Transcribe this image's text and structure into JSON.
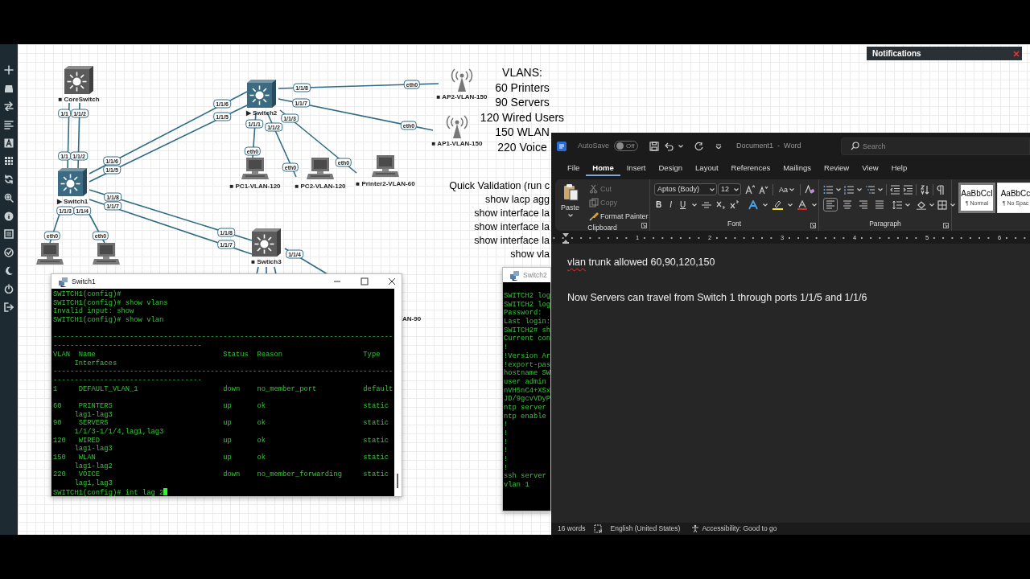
{
  "diagram": {
    "nodes": [
      {
        "kind": "switch",
        "label": "■ CoreSwitch",
        "color": "#5b5b5b"
      },
      {
        "kind": "switch",
        "label": "▶ Switch2",
        "color": "#3a6b82"
      },
      {
        "kind": "ap",
        "label": "■ AP2-VLAN-150"
      },
      {
        "kind": "ap",
        "label": "■ AP1-VLAN-150"
      },
      {
        "kind": "pc",
        "label": "■ PC1-VLAN-120"
      },
      {
        "kind": "pc",
        "label": "■ PC2-VLAN-120"
      },
      {
        "kind": "pc",
        "label": "■ Printer2-VLAN-60"
      },
      {
        "kind": "switch",
        "label": "▶ Switch1",
        "color": "#3a6b82"
      },
      {
        "kind": "switch",
        "label": "■ Swtich3",
        "color": "#5b5b5b"
      },
      {
        "kind": "pc"
      },
      {
        "kind": "pc"
      },
      {
        "kind": "label",
        "label": "AN-90"
      }
    ],
    "ports": [
      "1/1",
      "1/1/2",
      "1/1",
      "1/1/2",
      "1/1/6",
      "1/1/5",
      "1/1/8",
      "1/1/7",
      "1/1/3",
      "1/1/4",
      "1/1/6",
      "1/1/5",
      "1/1/8",
      "1/1/7",
      "1/1/3",
      "1/1/1",
      "1/1/2",
      "eth0",
      "eth0",
      "eth0",
      "eth0",
      "eth0",
      "eth0",
      "eth0",
      "1/1/8",
      "1/1/7",
      "1/1/4"
    ],
    "vlan_note": [
      "VLANS:",
      "60 Printers",
      "90 Servers",
      "120 Wired Users",
      "150 WLAN",
      "220 Voice"
    ],
    "validation_note": [
      "Quick Validation (run c",
      "show lacp agg",
      "show interface la",
      "show interface la",
      "show interface la",
      "show vla"
    ]
  },
  "notifications": {
    "title": "Notifications"
  },
  "switch1": {
    "title": "Switch1",
    "lines": [
      "SWITCH1(config)#",
      "SWITCH1(config)# show vlans",
      "Invalid input: show",
      "SWITCH1(config)# show vlan"
    ],
    "rules_top": [
      "--------------------------------------------------------------------------------",
      "-----------------------------------"
    ],
    "header": {
      "vlan": "VLAN",
      "name": "Name",
      "status": "Status",
      "reason": "Reason",
      "type": "Type",
      "interfaces": "Interfaces"
    },
    "rules_bottom": [
      "--------------------------------------------------------------------------------",
      "-----------------------------------"
    ],
    "rows": [
      {
        "vlan": "1",
        "name": "DEFAULT_VLAN_1",
        "status": "down",
        "reason": "no_member_port",
        "type": "default"
      },
      {
        "vlan": "60",
        "name": "PRINTERS",
        "status": "up",
        "reason": "ok",
        "type": "static",
        "interfaces": "lag1-lag3"
      },
      {
        "vlan": "90",
        "name": "SERVERS",
        "status": "up",
        "reason": "ok",
        "type": "static",
        "interfaces": "1/1/3-1/1/4,lag1,lag3"
      },
      {
        "vlan": "120",
        "name": "WIRED",
        "status": "up",
        "reason": "ok",
        "type": "static",
        "interfaces": "lag1-lag3"
      },
      {
        "vlan": "150",
        "name": "WLAN",
        "status": "up",
        "reason": "ok",
        "type": "static",
        "interfaces": "lag1-lag2"
      },
      {
        "vlan": "220",
        "name": "VOICE",
        "status": "down",
        "reason": "no_member_forwarding",
        "type": "static",
        "interfaces": "lag1,lag3"
      }
    ],
    "prompt": "SWITCH1(config)# int lag 2"
  },
  "switch2": {
    "title": "Switch2",
    "lines": [
      "SWITCH2 log",
      "SWITCH2 log",
      "Password:",
      "Last login:",
      "SWITCH2# sh",
      "Current con",
      "!",
      "!Version Ar",
      "!export-pas",
      "hostname SW",
      "user admin",
      "nVH5nC4+XSx",
      "JD/9gcvVDyP",
      "ntp server",
      "ntp enable",
      "!",
      "!",
      "!",
      "!",
      "!",
      "!",
      "ssh server",
      "vlan 1"
    ]
  },
  "word": {
    "autosave_label": "AutoSave",
    "autosave": {
      "on": false,
      "label": "Off"
    },
    "title": "Document1  -  Word",
    "search_placeholder": "Search",
    "tabs": [
      {
        "label": "File",
        "selected": false
      },
      {
        "label": "Home",
        "selected": true
      },
      {
        "label": "Insert",
        "selected": false
      },
      {
        "label": "Design",
        "selected": false
      },
      {
        "label": "Layout",
        "selected": false
      },
      {
        "label": "References",
        "selected": false
      },
      {
        "label": "Mailings",
        "selected": false
      },
      {
        "label": "Review",
        "selected": false
      },
      {
        "label": "View",
        "selected": false
      },
      {
        "label": "Help",
        "selected": false
      }
    ],
    "paste": "Paste",
    "clipboard_items": [
      {
        "label": "Cut",
        "disabled": true
      },
      {
        "label": "Copy",
        "disabled": true
      },
      {
        "label": "Format Painter",
        "disabled": false
      }
    ],
    "clipboard_group": "Clipboard",
    "font_name": "Aptos (Body)",
    "font_size": "12",
    "change_case": "Aa",
    "style_buttons": [
      "B",
      "I",
      "U"
    ],
    "font_group": "Font",
    "alignments": [
      {
        "selected": true
      },
      {
        "selected": false
      },
      {
        "selected": false
      },
      {
        "selected": false
      }
    ],
    "paragraph_group": "Paragraph",
    "styles": [
      {
        "sample": "AaBbCcI",
        "name": "¶ Normal",
        "selected": true
      },
      {
        "sample": "AaBbCc",
        "name": "¶ No Spac",
        "selected": false
      }
    ],
    "ruler": [
      "1",
      "2",
      "3",
      "4",
      "5",
      "6"
    ],
    "paragraphs": [
      [
        {
          "text": "vlan",
          "misspelled": true
        },
        {
          "text": " trunk allowed 60,90,120,150",
          "misspelled": false
        }
      ],
      [
        {
          "text": "Now Servers can travel from Switch 1 through ports 1/1/5 and 1/1/6",
          "misspelled": false
        }
      ]
    ],
    "status": {
      "words": "16 words",
      "language": "English (United States)",
      "accessibility": "Accessibility: Good to go"
    }
  }
}
